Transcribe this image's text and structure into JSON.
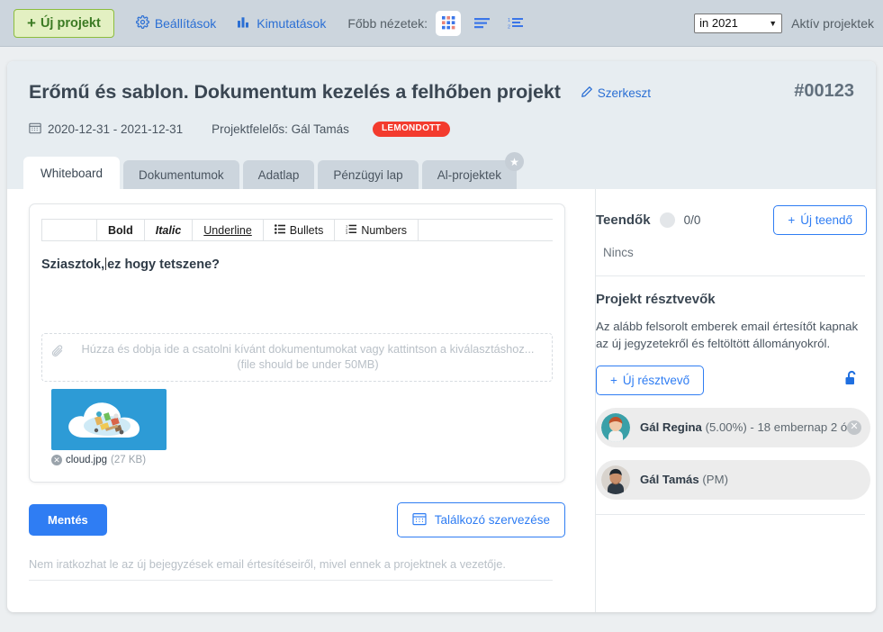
{
  "toolbar": {
    "new_project_label": "Új projekt",
    "settings_label": "Beállítások",
    "reports_label": "Kimutatások",
    "main_views_label": "Főbb nézetek:",
    "view_icons": [
      "grid-view-icon",
      "list-view-icon",
      "numbered-list-view-icon"
    ],
    "year_selected": "in 2021",
    "year_options": [
      "in 2021"
    ],
    "active_projects_label": "Aktív projektek",
    "accent_blue": "#2b6fd4",
    "new_project_green": "#8cbd3f"
  },
  "project": {
    "title": "Erőmű és sablon. Dokumentum kezelés a felhőben projekt",
    "edit_label": "Szerkeszt",
    "id": "#00123",
    "date_range": "2020-12-31 - 2021-12-31",
    "owner": "Projektfelelős: Gál Tamás",
    "status_badge": "LEMONDOTT",
    "status_color": "#f33b2e"
  },
  "tabs": [
    {
      "label": "Whiteboard",
      "active": true,
      "badge": ""
    },
    {
      "label": "Dokumentumok",
      "active": false,
      "badge": ""
    },
    {
      "label": "Adatlap",
      "active": false,
      "badge": ""
    },
    {
      "label": "Pénzügyi lap",
      "active": false,
      "badge": ""
    },
    {
      "label": "Al-projektek",
      "active": false,
      "badge": "★"
    }
  ],
  "editor": {
    "toolbar_buttons": [
      {
        "label": "",
        "icon": ""
      },
      {
        "label": "Bold",
        "icon": ""
      },
      {
        "label": "Italic",
        "icon": ""
      },
      {
        "label": "Underline",
        "icon": ""
      },
      {
        "label": "Bullets",
        "icon": "bullet-list-icon"
      },
      {
        "label": "Numbers",
        "icon": "numbered-list-icon"
      }
    ],
    "bold_label": "Bold",
    "italic_label": "Italic",
    "underline_label": "Underline",
    "bullets_label": "Bullets",
    "numbers_label": "Numbers",
    "body_text_before": "Sziasztok,",
    "body_text_after": "ez hogy tetszene?",
    "dropzone_line1": "Húzza és dobja ide a csatolni kívánt dokumentumokat vagy kattintson a kiválasztáshoz...",
    "dropzone_line2": "(file should be under 50MB)",
    "attachment_name": "cloud.jpg",
    "attachment_size": "(27 KB)",
    "save_label": "Mentés",
    "meeting_label": "Találkozó szervezése",
    "footer_note": "Nem iratkozhat le az új bejegyzések email értesítéseiről, mivel ennek a projektnek a vezetője."
  },
  "sidebar": {
    "todos_title": "Teendők",
    "todos_count": "0/0",
    "new_todo_label": "Új teendő",
    "todos_empty": "Nincs",
    "participants_title": "Projekt résztvevők",
    "participants_desc": "Az alább felsorolt emberek email értesítőt kapnak az új jegyzetekről és feltöltött állományokról.",
    "new_participant_label": "Új résztvevő",
    "participants": [
      {
        "name": "Gál Regina",
        "detail": "(5.00%) - 18 embernap 2 ó...",
        "removable": true
      },
      {
        "name": "Gál Tamás",
        "detail": "(PM)",
        "removable": false
      }
    ]
  }
}
